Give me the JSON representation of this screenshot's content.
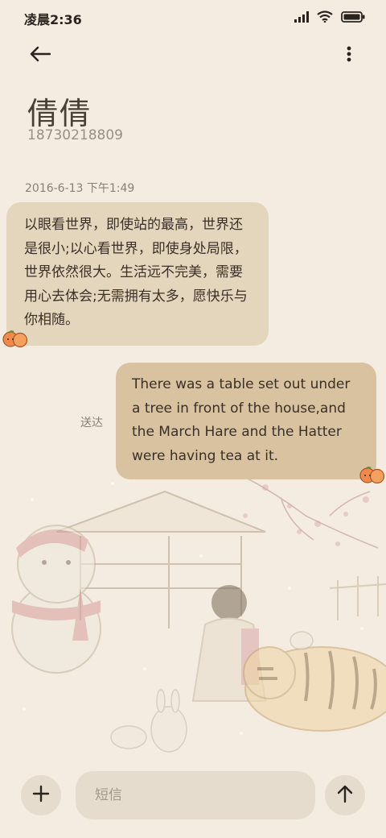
{
  "status_bar": {
    "time": "凌晨2:36",
    "icons": [
      "signal-icon",
      "wifi-icon",
      "battery-icon"
    ]
  },
  "header": {
    "back_icon": "back-arrow-icon",
    "more_icon": "more-vertical-icon"
  },
  "contact": {
    "name": "倩倩",
    "phone": "18730218809"
  },
  "conversation": {
    "timestamp": "2016-6-13 下午1:49",
    "messages": [
      {
        "direction": "incoming",
        "text": "以眼看世界，即使站的最高，世界还是很小;以心看世界，即使身处局限，世界依然很大。生活远不完美，需要用心去体会;无需拥有太多，愿快乐与你相随。"
      },
      {
        "direction": "outgoing",
        "text": "There was a table set out under a tree in front of the house,and the March Hare and the Hatter were having tea at it.",
        "status": "送达"
      }
    ]
  },
  "composer": {
    "placeholder": "短信",
    "add_icon": "plus-icon",
    "send_icon": "send-arrow-icon"
  },
  "colors": {
    "background": "#f4ece0",
    "incoming_bubble": "#e4d5bd",
    "outgoing_bubble": "#d9c2a0",
    "accent_sticker": "#f08a4b"
  }
}
